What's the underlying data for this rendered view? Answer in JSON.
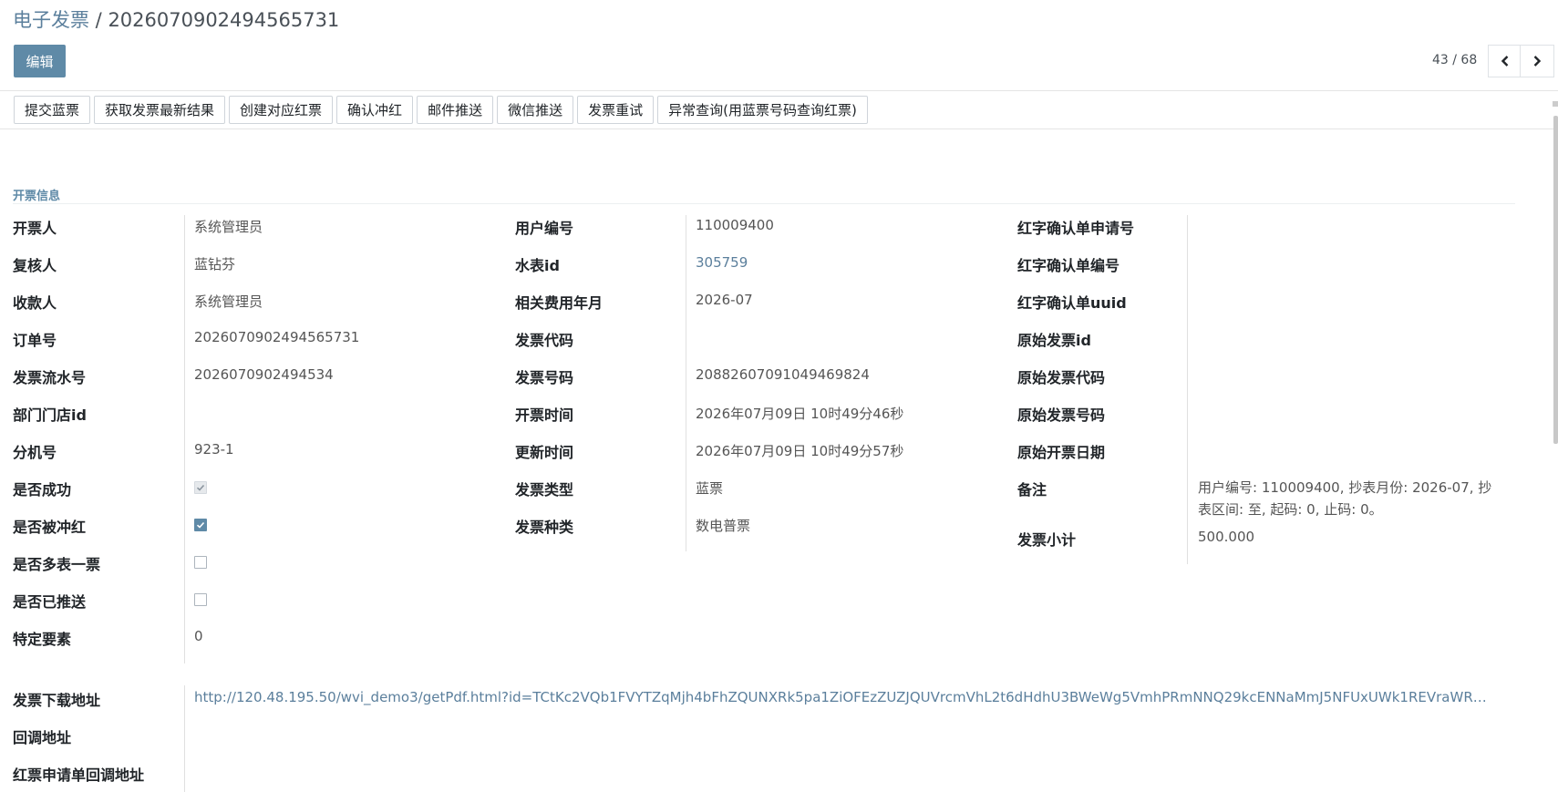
{
  "breadcrumb": {
    "root": "电子发票",
    "separator": " / ",
    "current": "2026070902494565731"
  },
  "toolbar": {
    "edit_label": "编辑"
  },
  "pager": {
    "text": "43 / 68",
    "prev_icon": "chevron-left-icon",
    "next_icon": "chevron-right-icon"
  },
  "actions": [
    "提交蓝票",
    "获取发票最新结果",
    "创建对应红票",
    "确认冲红",
    "邮件推送",
    "微信推送",
    "发票重试",
    "异常查询(用蓝票号码查询红票)"
  ],
  "section_title": "开票信息",
  "col1": {
    "drawer_label": "开票人",
    "drawer": "系统管理员",
    "reviewer_label": "复核人",
    "reviewer": "蓝钻芬",
    "payee_label": "收款人",
    "payee": "系统管理员",
    "order_label": "订单号",
    "order": "2026070902494565731",
    "serial_label": "发票流水号",
    "serial": "2026070902494534",
    "dept_label": "部门门店id",
    "dept": "",
    "ext_label": "分机号",
    "ext": "923-1",
    "success_label": "是否成功",
    "success": true,
    "reversed_label": "是否被冲红",
    "reversed": true,
    "multi_label": "是否多表一票",
    "multi": false,
    "pushed_label": "是否已推送",
    "pushed": false,
    "special_label": "特定要素",
    "special": "0"
  },
  "col2": {
    "user_no_label": "用户编号",
    "user_no": "110009400",
    "meter_label": "水表id",
    "meter": "305759",
    "period_label": "相关费用年月",
    "period": "2026-07",
    "code_label": "发票代码",
    "code": "",
    "number_label": "发票号码",
    "number": "20882607091049469824",
    "issue_time_label": "开票时间",
    "issue_time": "2026年07月09日 10时49分46秒",
    "update_time_label": "更新时间",
    "update_time": "2026年07月09日 10时49分57秒",
    "type_label": "发票类型",
    "type": "蓝票",
    "kind_label": "发票种类",
    "kind": "数电普票"
  },
  "col3": {
    "red_apply_label": "红字确认单申请号",
    "red_apply": "",
    "red_no_label": "红字确认单编号",
    "red_no": "",
    "red_uuid_label": "红字确认单uuid",
    "red_uuid": "",
    "orig_id_label": "原始发票id",
    "orig_id": "",
    "orig_code_label": "原始发票代码",
    "orig_code": "",
    "orig_number_label": "原始发票号码",
    "orig_number": "",
    "orig_date_label": "原始开票日期",
    "orig_date": "",
    "remark_label": "备注",
    "remark": "用户编号: 110009400, 抄表月份: 2026-07, 抄表区间: 至, 起码: 0, 止码: 0。",
    "subtotal_label": "发票小计",
    "subtotal": "500.000"
  },
  "bottom": {
    "download_label": "发票下载地址",
    "download_url": "http://120.48.195.50/wvi_demo3/getPdf.html?id=TCtKc2VQb1FVYTZqMjh4bFhZQUNXRk5pa1ZiOFEzZUZJQUVrcmVhL2t6dHdhU3BWeWg5VmhPRmNNQ29kcENNaMmJ5NFUxUWk1REVraWR2UDQ...",
    "callback_label": "回调地址",
    "callback": "",
    "red_callback_label": "红票申请单回调地址",
    "red_callback": ""
  }
}
